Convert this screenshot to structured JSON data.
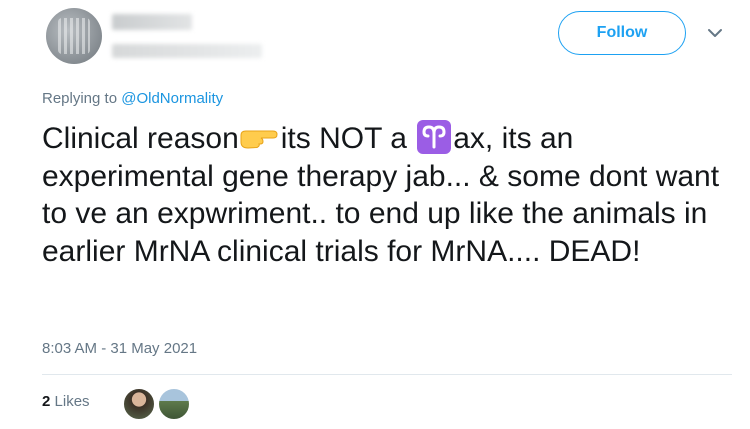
{
  "header": {
    "follow_label": "Follow"
  },
  "tweet": {
    "replying_prefix": "Replying to",
    "replying_to": "@OldNormality",
    "text_part1": "Clinical reason",
    "text_part2": "its NOT a ",
    "text_part3": "ax, its an experimental gene therapy jab...  & some dont want to ve an expwriment..  to end up like the animals in earlier MrNA clinical trials for MrNA.... DEAD!",
    "timestamp": "8:03 AM - 31 May 2021"
  },
  "engagement": {
    "likes_count": "2",
    "likes_label": "Likes"
  },
  "icons": {
    "emoji_1": "backhand-index-pointing-right-emoji",
    "emoji_2": "aries-emoji"
  },
  "colors": {
    "accent": "#1da1f2",
    "mention": "#1b95e0",
    "muted": "#657786",
    "aries_bg": "#9b5de5"
  }
}
